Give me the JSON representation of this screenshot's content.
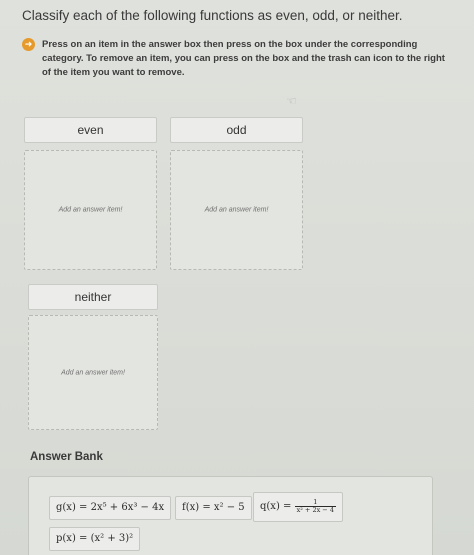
{
  "question": "Classify each of the following functions as even, odd, or neither.",
  "instructions": "Press on an item in the answer box then press on the box under the corresponding category. To remove an item, you can press on the box and the trash can icon to the right of the item you want to remove.",
  "icons": {
    "instruction": "arrow-right-icon",
    "pointer": "hand-pointer-icon"
  },
  "categories": {
    "even": {
      "label": "even",
      "hint": "Add an answer item!"
    },
    "odd": {
      "label": "odd",
      "hint": "Add an answer item!"
    },
    "neither": {
      "label": "neither",
      "hint": "Add an answer item!"
    }
  },
  "answer_bank": {
    "title": "Answer Bank",
    "items": {
      "g": {
        "lhs": "g(x) =",
        "expr": "2x⁵ + 6x³ − 4x"
      },
      "f": {
        "lhs": "f(x) =",
        "expr": "x² − 5"
      },
      "q": {
        "lhs": "q(x) =",
        "num": "1",
        "den": "x² + 2x − 4"
      },
      "p": {
        "lhs": "p(x) =",
        "expr": "(x² + 3)²"
      }
    }
  },
  "colors": {
    "accent": "#e69a2c",
    "background": "#d9dcd6"
  }
}
